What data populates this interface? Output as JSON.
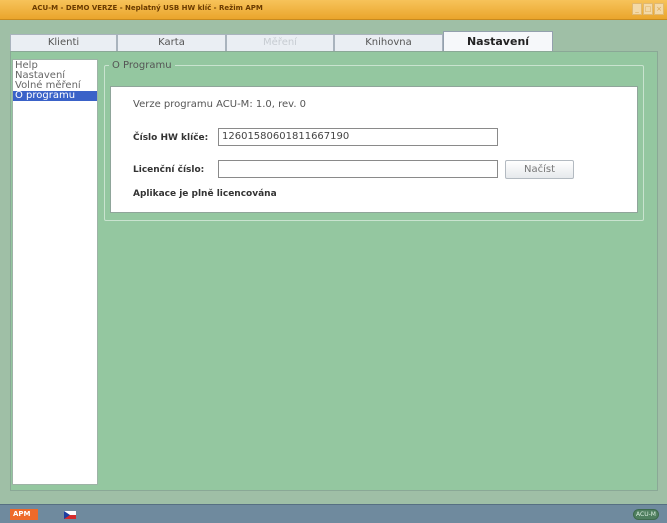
{
  "window": {
    "title": "ACU-M - DEMO VERZE - Neplatný USB HW klíč - Režim APM",
    "controls": [
      "minimize-icon",
      "maximize-icon",
      "close-icon"
    ]
  },
  "tabs": [
    {
      "label": "Klienti",
      "state": "normal"
    },
    {
      "label": "Karta",
      "state": "normal"
    },
    {
      "label": "Měření",
      "state": "disabled"
    },
    {
      "label": "Knihovna",
      "state": "normal"
    },
    {
      "label": "Nastavení",
      "state": "active"
    }
  ],
  "sidebar": {
    "items": [
      {
        "label": "Help",
        "selected": false
      },
      {
        "label": "Nastavení",
        "selected": false
      },
      {
        "label": "Volné měření",
        "selected": false
      },
      {
        "label": "O programu",
        "selected": true
      }
    ]
  },
  "content": {
    "group_title": "O Programu",
    "version_label": "Verze programu ACU-M:",
    "version_value": "1.0, rev. 0",
    "hw_key_label": "Číslo HW klíče:",
    "hw_key_value": "12601580601811667190",
    "license_label": "Licenční číslo:",
    "license_value": "",
    "load_button": "Načíst",
    "license_status": "Aplikace je plně licencována"
  },
  "statusbar": {
    "mode_badge": "APM",
    "language_flag": "czech-flag-icon",
    "logo": "ACU-M"
  },
  "colors": {
    "titlebar": "#eaa52c",
    "background": "#94c7a0",
    "selection": "#3a62c8",
    "statusbar": "#6f8a9e",
    "apm_badge": "#ee6a2a"
  }
}
